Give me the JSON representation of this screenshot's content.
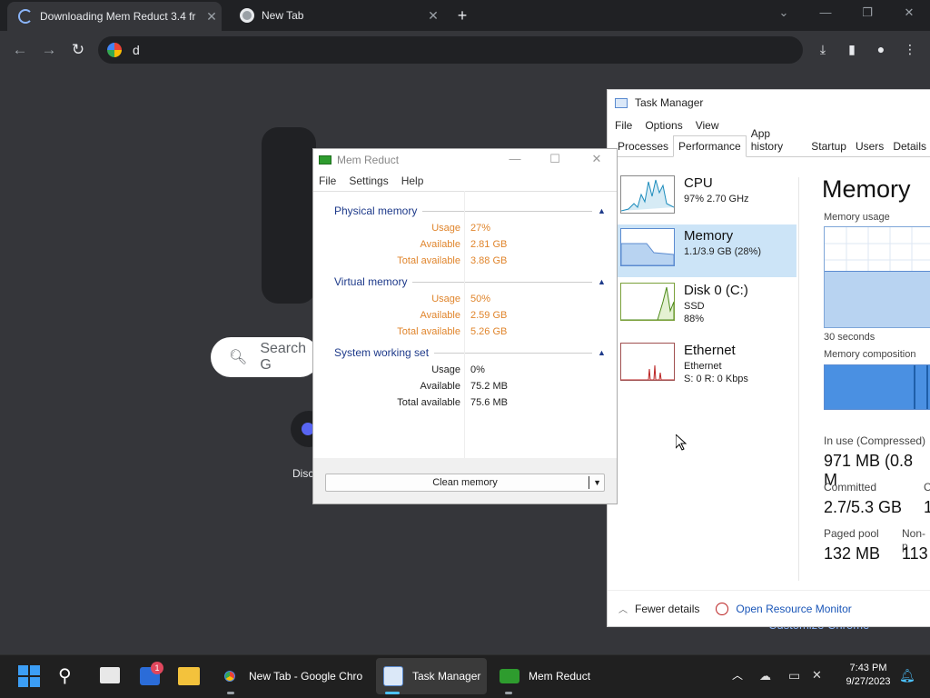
{
  "browser": {
    "tabs": [
      {
        "title": "Downloading Mem Reduct 3.4 fr",
        "icon": "loading-spinner"
      },
      {
        "title": "New Tab",
        "icon": "chrome-icon"
      }
    ],
    "omnibox_value": "d",
    "ntp": {
      "search_placeholder": "Search G",
      "shortcut_label": "Disc",
      "customize": "Customize Chrome"
    }
  },
  "mem_reduct": {
    "title": "Mem Reduct",
    "menu": [
      "File",
      "Settings",
      "Help"
    ],
    "groups": [
      {
        "name": "Physical memory",
        "rows": [
          {
            "k": "Usage",
            "v": "27%"
          },
          {
            "k": "Available",
            "v": "2.81 GB"
          },
          {
            "k": "Total available",
            "v": "3.88 GB"
          }
        ]
      },
      {
        "name": "Virtual memory",
        "rows": [
          {
            "k": "Usage",
            "v": "50%"
          },
          {
            "k": "Available",
            "v": "2.59 GB"
          },
          {
            "k": "Total available",
            "v": "5.26 GB"
          }
        ]
      },
      {
        "name": "System working set",
        "rows": [
          {
            "k": "Usage",
            "v": "0%"
          },
          {
            "k": "Available",
            "v": "75.2 MB"
          },
          {
            "k": "Total available",
            "v": "75.6 MB"
          }
        ]
      }
    ],
    "clean_button": "Clean memory"
  },
  "task_manager": {
    "title": "Task Manager",
    "menu": [
      "File",
      "Options",
      "View"
    ],
    "tabs": [
      "Processes",
      "Performance",
      "App history",
      "Startup",
      "Users",
      "Details"
    ],
    "selected_tab": "Performance",
    "sidebar": [
      {
        "name": "CPU",
        "s1": "97%  2.70 GHz",
        "s2": ""
      },
      {
        "name": "Memory",
        "s1": "1.1/3.9 GB (28%)",
        "s2": ""
      },
      {
        "name": "Disk 0 (C:)",
        "s1": "SSD",
        "s2": "88%"
      },
      {
        "name": "Ethernet",
        "s1": "Ethernet",
        "s2": "S: 0  R: 0 Kbps"
      }
    ],
    "heading": "Memory",
    "memory_usage_label": "Memory usage",
    "seconds_label": "30 seconds",
    "composition_label": "Memory composition",
    "memory_usage_fraction": 0.28,
    "in_use_label": "In use (Compressed)",
    "in_use_value": "971 MB (0.8 M",
    "committed_label": "Committed",
    "committed_value": "2.7/5.3 GB",
    "cached_label_partial": "C",
    "cached_value_partial": "1",
    "paged_label": "Paged pool",
    "paged_value": "132 MB",
    "nonpaged_label": "Non-p",
    "nonpaged_value": "113",
    "fewer_details": "Fewer details",
    "open_resmon": "Open Resource Monitor"
  },
  "taskbar": {
    "items": [
      {
        "label": "New Tab - Google Chro",
        "icon": "chrome-icon"
      },
      {
        "label": "Task Manager",
        "icon": "task-manager-icon"
      },
      {
        "label": "Mem Reduct",
        "icon": "mem-reduct-icon"
      }
    ],
    "badge": "1",
    "time": "7:43 PM",
    "date": "9/27/2023"
  }
}
